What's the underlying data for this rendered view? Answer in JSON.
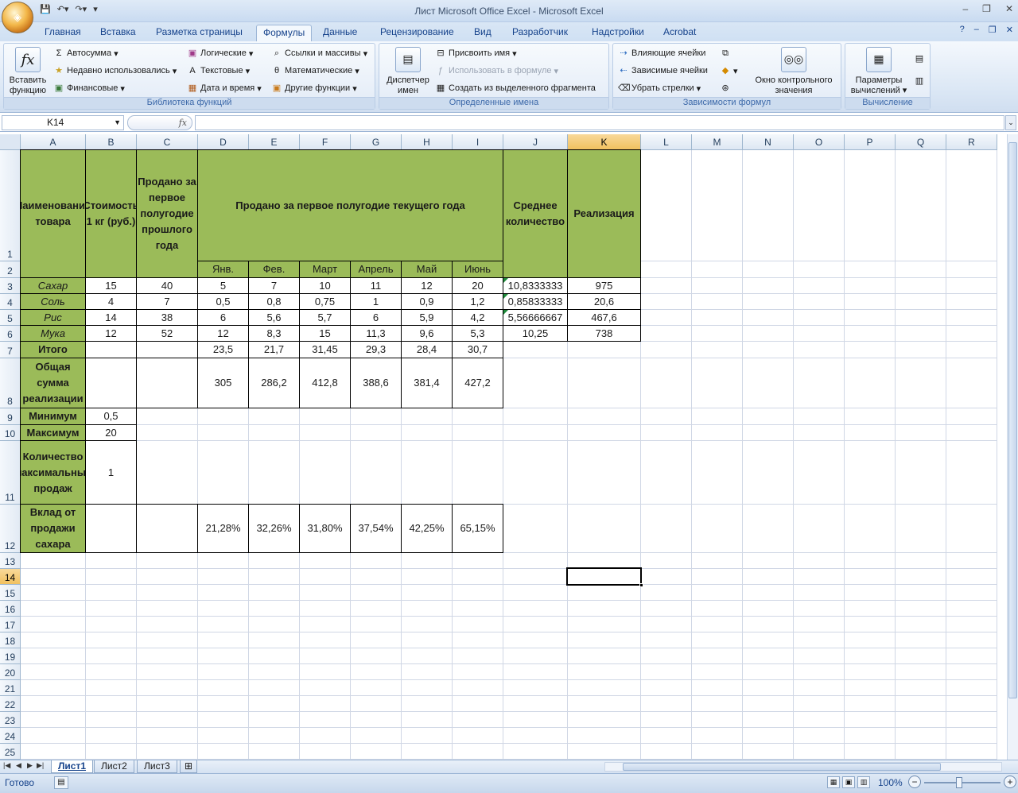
{
  "window": {
    "title": "Лист Microsoft Office Excel - Microsoft Excel",
    "office_button_label": "",
    "qat": [
      "save-icon",
      "undo-icon",
      "redo-icon",
      "customize-icon"
    ],
    "controls": [
      "–",
      "❐",
      "✕"
    ],
    "doc_controls": [
      "–",
      "❐",
      "✕"
    ]
  },
  "ribbon": {
    "tabs": [
      "Главная",
      "Вставка",
      "Разметка страницы",
      "Формулы",
      "Данные",
      "Рецензирование",
      "Вид",
      "Разработчик",
      "Надстройки",
      "Acrobat"
    ],
    "active_tab": "Формулы",
    "groups": {
      "library": {
        "label": "Библиотека функций",
        "insert_function": "Вставить функцию",
        "autosum": "Автосумма",
        "recent": "Недавно использовались",
        "financial": "Финансовые",
        "logical": "Логические",
        "text": "Текстовые",
        "datetime": "Дата и время",
        "lookup": "Ссылки и массивы",
        "math": "Математические",
        "more": "Другие функции"
      },
      "names": {
        "label": "Определенные имена",
        "manager": "Диспетчер имен",
        "define": "Присвоить имя",
        "use_in_formula": "Использовать в формуле",
        "create_from_selection": "Создать из выделенного фрагмента"
      },
      "auditing": {
        "label": "Зависимости формул",
        "precedents": "Влияющие ячейки",
        "dependents": "Зависимые ячейки",
        "remove_arrows": "Убрать стрелки",
        "watch_window": "Окно контрольного значения"
      },
      "calculation": {
        "label": "Вычисление",
        "options": "Параметры вычислений"
      }
    }
  },
  "formula_bar": {
    "name_box": "K14",
    "fx": "fx",
    "formula": ""
  },
  "grid": {
    "columns": [
      "A",
      "B",
      "C",
      "D",
      "E",
      "F",
      "G",
      "H",
      "I",
      "J",
      "K",
      "L",
      "M",
      "N",
      "O",
      "P",
      "Q",
      "R"
    ],
    "rows": [
      "1",
      "2",
      "3",
      "4",
      "5",
      "6",
      "7",
      "8",
      "9",
      "10",
      "11",
      "12",
      "13",
      "14",
      "15",
      "16",
      "17",
      "18",
      "19",
      "20",
      "21",
      "22",
      "23",
      "24",
      "25"
    ],
    "selected_column": "K",
    "selected_row": "14",
    "cells": {
      "A1": "Наименование товара",
      "B1": "Стоимость 1 кг (руб.)",
      "C1": "Продано за первое полугодие прошлого года",
      "D1": "Продано за первое полугодие текущего года",
      "J1": "Среднее количество",
      "K1": "Реализация",
      "D2": "Янв.",
      "E2": "Фев.",
      "F2": "Март",
      "G2": "Апрель",
      "H2": "Май",
      "I2": "Июнь",
      "A3": "Сахар",
      "B3": "15",
      "C3": "40",
      "D3": "5",
      "E3": "7",
      "F3": "10",
      "G3": "11",
      "H3": "12",
      "I3": "20",
      "J3": "10,8333333",
      "K3": "975",
      "A4": "Соль",
      "B4": "4",
      "C4": "7",
      "D4": "0,5",
      "E4": "0,8",
      "F4": "0,75",
      "G4": "1",
      "H4": "0,9",
      "I4": "1,2",
      "J4": "0,85833333",
      "K4": "20,6",
      "A5": "Рис",
      "B5": "14",
      "C5": "38",
      "D5": "6",
      "E5": "5,6",
      "F5": "5,7",
      "G5": "6",
      "H5": "5,9",
      "I5": "4,2",
      "J5": "5,56666667",
      "K5": "467,6",
      "A6": "Мука",
      "B6": "12",
      "C6": "52",
      "D6": "12",
      "E6": "8,3",
      "F6": "15",
      "G6": "11,3",
      "H6": "9,6",
      "I6": "5,3",
      "J6": "10,25",
      "K6": "738",
      "A7": "Итого",
      "D7": "23,5",
      "E7": "21,7",
      "F7": "31,45",
      "G7": "29,3",
      "H7": "28,4",
      "I7": "30,7",
      "A8": "Общая сумма реализации",
      "D8": "305",
      "E8": "286,2",
      "F8": "412,8",
      "G8": "388,6",
      "H8": "381,4",
      "I8": "427,2",
      "A9": "Минимум",
      "B9": "0,5",
      "A10": "Максимум",
      "B10": "20",
      "A11": "Количество максимальных продаж",
      "B11": "1",
      "A12": "Вклад от продажи сахара",
      "D12": "21,28%",
      "E12": "32,26%",
      "F12": "31,80%",
      "G12": "37,54%",
      "H12": "42,25%",
      "I12": "65,15%"
    }
  },
  "sheets": {
    "tabs": [
      "Лист1",
      "Лист2",
      "Лист3"
    ],
    "active": "Лист1"
  },
  "status": {
    "ready": "Готово",
    "zoom": "100%"
  },
  "colors": {
    "header_fill": "#9bbb59",
    "selection_header": "#f1c15f",
    "ribbon_text": "#15428b"
  }
}
